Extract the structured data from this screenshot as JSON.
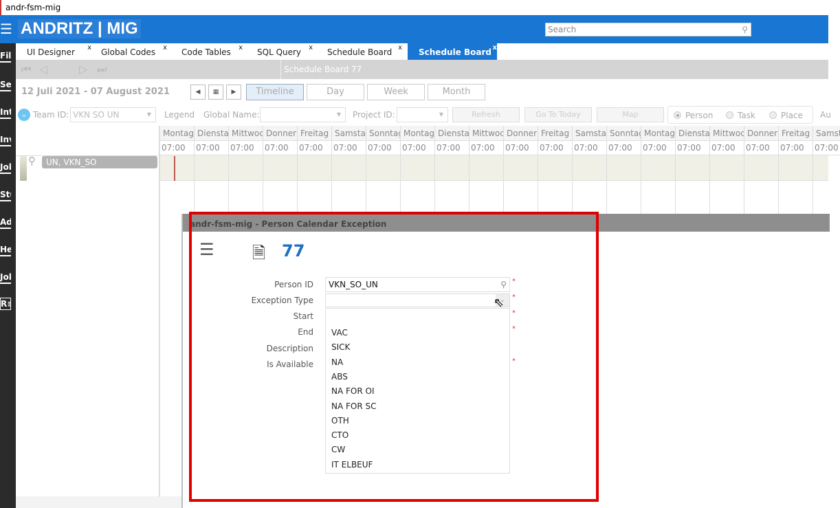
{
  "window_title": "andr-fsm-mig",
  "header": {
    "logo": "ANDRITZ | MIG",
    "search_placeholder": "Search"
  },
  "sidebar": {
    "items": [
      "Fil",
      "Ser",
      "Int",
      "Inv",
      "Job",
      "Stu",
      "Adm",
      "Hel",
      "Job"
    ]
  },
  "tabs": [
    {
      "label": "UI Designer",
      "close": "x"
    },
    {
      "label": "Global Codes",
      "close": "x"
    },
    {
      "label": "Code Tables",
      "close": "x"
    },
    {
      "label": "SQL Query",
      "close": "x"
    },
    {
      "label": "Schedule Board",
      "close": "x"
    },
    {
      "label": "Schedule Board",
      "close": "x",
      "active": true
    }
  ],
  "toolbar": {
    "title": "Schedule Board 77"
  },
  "schedule": {
    "date_range": "12 Juli 2021 - 07 August 2021",
    "views": [
      "Timeline",
      "Day",
      "Week",
      "Month"
    ],
    "active_view": "Timeline",
    "team_id_label": "Team ID:",
    "team_id_value": "VKN SO UN",
    "legend_label": "Legend",
    "global_name_label": "Global Name:",
    "project_id_label": "Project ID:",
    "buttons": [
      "Refresh",
      "Go To Today",
      "Map"
    ],
    "radios": [
      {
        "label": "Person",
        "checked": true
      },
      {
        "label": "Task",
        "checked": false
      },
      {
        "label": "Place",
        "checked": false
      }
    ],
    "extra_label": "Au",
    "days": [
      "Montag",
      "Diensta",
      "Mittwoc",
      "Donner",
      "Freitag",
      "Samstag",
      "Sonntag",
      "Montag",
      "Diensta",
      "Mittwoc",
      "Donner",
      "Freitag",
      "Samstag",
      "Sonntag",
      "Montag",
      "Diensta",
      "Mittwoc",
      "Donner",
      "Freitag",
      "Samstag"
    ],
    "time": "07:00",
    "person": "UN, VKN_SO"
  },
  "dialog": {
    "title": "andr-fsm-mig - Person Calendar Exception",
    "record_number": "77",
    "fields": [
      {
        "label": "Person ID",
        "value": "VKN_SO_UN",
        "required": true
      },
      {
        "label": "Exception Type",
        "value": "",
        "required": true
      },
      {
        "label": "Start",
        "required": true
      },
      {
        "label": "End",
        "required": true
      },
      {
        "label": "Description",
        "required": false
      },
      {
        "label": "Is Available",
        "required": true
      }
    ],
    "exception_type_options": [
      "VAC",
      "SICK",
      "NA",
      "ABS",
      "NA FOR OI",
      "NA FOR SC",
      "OTH",
      "CTO",
      "CW",
      "IT ELBEUF"
    ]
  },
  "colors": {
    "brand": "#1976d2",
    "highlight_box": "#e00000",
    "record_number": "#1f6fc0"
  }
}
